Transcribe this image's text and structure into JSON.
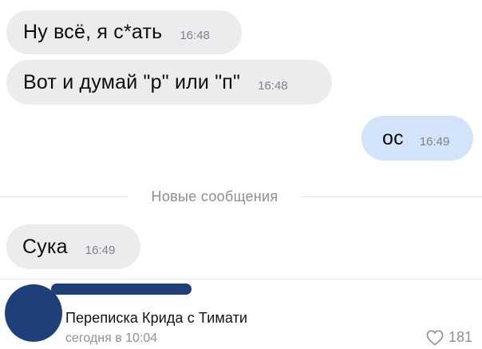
{
  "messages": [
    {
      "direction": "incoming",
      "text": "Ну всё, я с*ать",
      "time": "16:48"
    },
    {
      "direction": "incoming",
      "text": "Вот и думай \"р\" или \"п\"",
      "time": "16:48"
    },
    {
      "direction": "outgoing",
      "text": "ос",
      "time": "16:49"
    },
    {
      "direction": "incoming",
      "text": "Сука",
      "time": "16:49"
    }
  ],
  "divider": {
    "label": "Новые сообщения"
  },
  "post": {
    "title": "Переписка Крида с Тимати",
    "date": "сегодня в 10:04",
    "likes": "181",
    "like_icon": "heart-icon"
  },
  "colors": {
    "incoming_bubble": "#ececef",
    "outgoing_bubble": "#d3e3f9",
    "redaction": "#1f3f78"
  }
}
